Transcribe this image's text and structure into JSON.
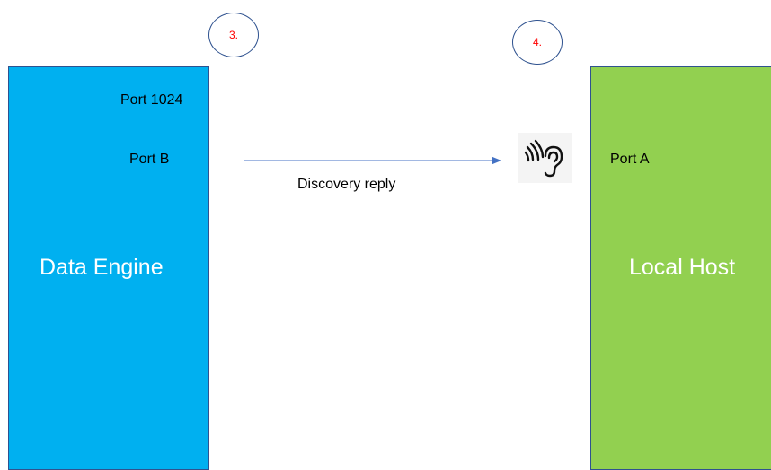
{
  "steps": {
    "step3": "3.",
    "step4": "4."
  },
  "data_engine": {
    "title": "Data Engine",
    "port_1024": "Port 1024",
    "port_b": "Port B"
  },
  "arrow": {
    "label": "Discovery reply"
  },
  "local_host": {
    "title": "Local Host",
    "port_a": "Port A"
  },
  "icons": {
    "listener": "ear-icon"
  },
  "colors": {
    "data_engine_fill": "#00b0f0",
    "local_host_fill": "#92d050",
    "outline": "#2f528f",
    "arrow": "#4472c4",
    "step_number": "#ff0000"
  }
}
